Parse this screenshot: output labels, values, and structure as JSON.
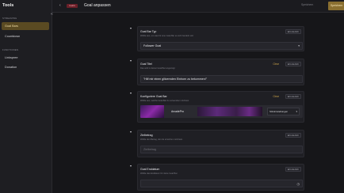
{
  "sidebar": {
    "title": "Tools",
    "sections": [
      {
        "label": "STREAMING",
        "items": [
          {
            "label": "Goal Bars",
            "active": true
          },
          {
            "label": "Countdown",
            "active": false
          }
        ]
      },
      {
        "label": "FUNKTIONEN",
        "items": [
          {
            "label": "Linkspree",
            "active": false
          },
          {
            "label": "Donation",
            "active": false
          }
        ]
      }
    ]
  },
  "header": {
    "back_icon": "arrow-left-icon",
    "badge": "Inaktiv",
    "title": "Goal anpassen",
    "secondary_button": "Speichern",
    "primary_button": "Speichern"
  },
  "cards": [
    {
      "title": "Goal Bar Typ",
      "description": "Wähle aus, um was für eine Goal-Bar es sich handeln soll.",
      "required": "Erforderlich",
      "value": "Follower Goal",
      "has_dropdown": true
    },
    {
      "title": "Goal Titel",
      "description": "Das wird in deiner Goal Bar angezeigt",
      "required": "Erforderlich",
      "clear": "Clear",
      "value": "\"Hilf mir einen glitzernden Einhorn zu bekommen!\""
    },
    {
      "title": "Konfiguriere Goal Bar",
      "description": "Wähle aus, welche Goal-Bar du verwenden möchtest.",
      "required": "Erforderlich",
      "clear": "Clear",
      "preview_name": "ArcadePro",
      "preview_select": "Stil-Einstellungen"
    },
    {
      "title": "Zielbetrag",
      "description": "Wähle den Betrag, den du erreichen möchtest.",
      "required": "Erforderlich",
      "placeholder": "Zielbetrag"
    },
    {
      "title": "Goal Enddatum",
      "description": "Wähle das Enddatum für deine Goal Bar.",
      "required": "Erforderlich"
    }
  ],
  "colors": {
    "accent": "#8a6f30",
    "background": "#161619",
    "card": "#1f1f24",
    "danger_badge": "#6a1f28"
  }
}
